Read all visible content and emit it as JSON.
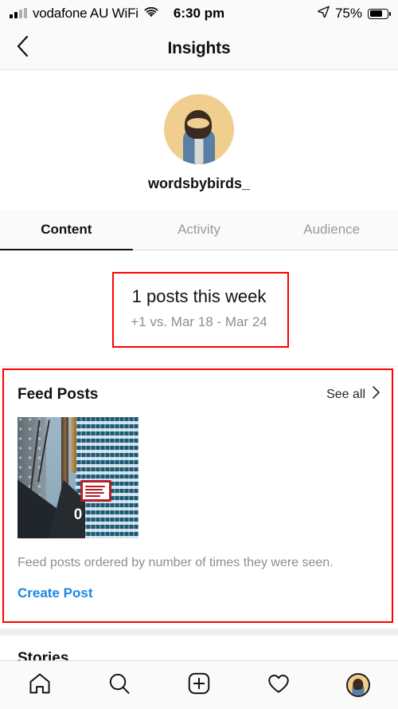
{
  "status_bar": {
    "carrier": "vodafone AU WiFi",
    "time": "6:30 pm",
    "battery_percent": "75%",
    "battery_level": 75,
    "icons": [
      "signal-bars-icon",
      "wifi-icon",
      "location-arrow-icon",
      "battery-icon"
    ]
  },
  "header": {
    "back_icon": "chevron-left-icon",
    "title": "Insights"
  },
  "profile": {
    "username": "wordsbybirds_",
    "avatar_alt": "profile-photo"
  },
  "tabs": [
    {
      "label": "Content",
      "active": true
    },
    {
      "label": "Activity",
      "active": false
    },
    {
      "label": "Audience",
      "active": false
    }
  ],
  "week_summary": {
    "headline": "1 posts this week",
    "comparison": "+1 vs. Mar 18 - Mar 24"
  },
  "feed_posts": {
    "title": "Feed Posts",
    "see_all": "See all",
    "see_all_icon": "chevron-right-icon",
    "post_count_overlay": "0",
    "note": "Feed posts ordered by number of times they were seen.",
    "create_post": "Create Post"
  },
  "stories": {
    "title": "Stories"
  },
  "bottom_nav": [
    {
      "name": "home-icon"
    },
    {
      "name": "search-icon"
    },
    {
      "name": "add-post-icon"
    },
    {
      "name": "heart-icon"
    },
    {
      "name": "profile-avatar-icon"
    }
  ],
  "colors": {
    "link_blue": "#1b87e6",
    "annotation_red": "#ff0000",
    "muted_gray": "#8e8e8e",
    "primary_text": "#111111"
  }
}
